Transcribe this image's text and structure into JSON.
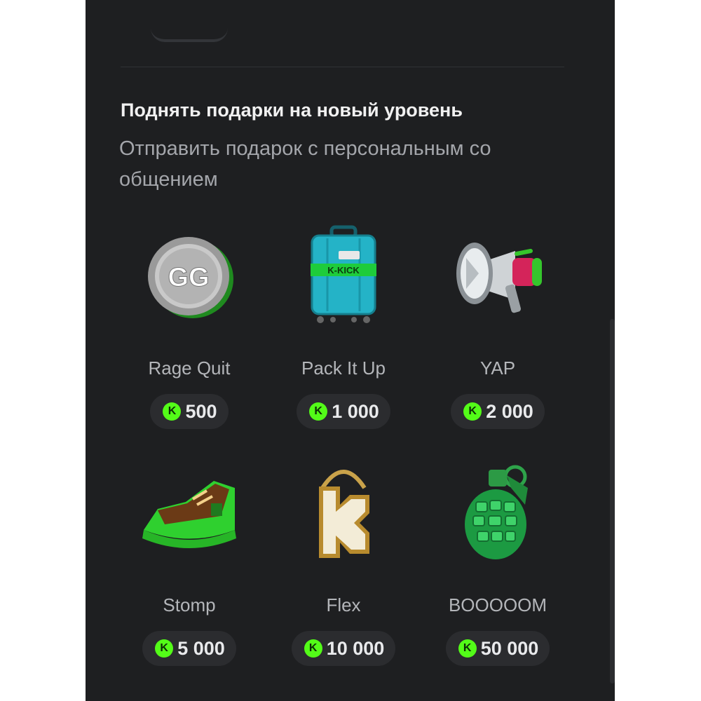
{
  "section": {
    "title": "Поднять подарки на новый уровень",
    "subtitle": "Отправить подарок с персональным со общением"
  },
  "gifts": [
    {
      "name": "Rage Quit",
      "price": "500",
      "icon": "gg-coin-icon"
    },
    {
      "name": "Pack It Up",
      "price": "1 000",
      "icon": "suitcase-icon"
    },
    {
      "name": "YAP",
      "price": "2 000",
      "icon": "megaphone-icon"
    },
    {
      "name": "Stomp",
      "price": "5 000",
      "icon": "sneaker-icon"
    },
    {
      "name": "Flex",
      "price": "10 000",
      "icon": "k-chain-pendant-icon"
    },
    {
      "name": "BOOOOOM",
      "price": "50 000",
      "icon": "grenade-icon"
    }
  ],
  "coin": {
    "symbol": "K",
    "color": "#53fc18"
  },
  "colors": {
    "panel": "#1e1f21",
    "pill": "#2b2c2f",
    "accent": "#53fc18"
  }
}
